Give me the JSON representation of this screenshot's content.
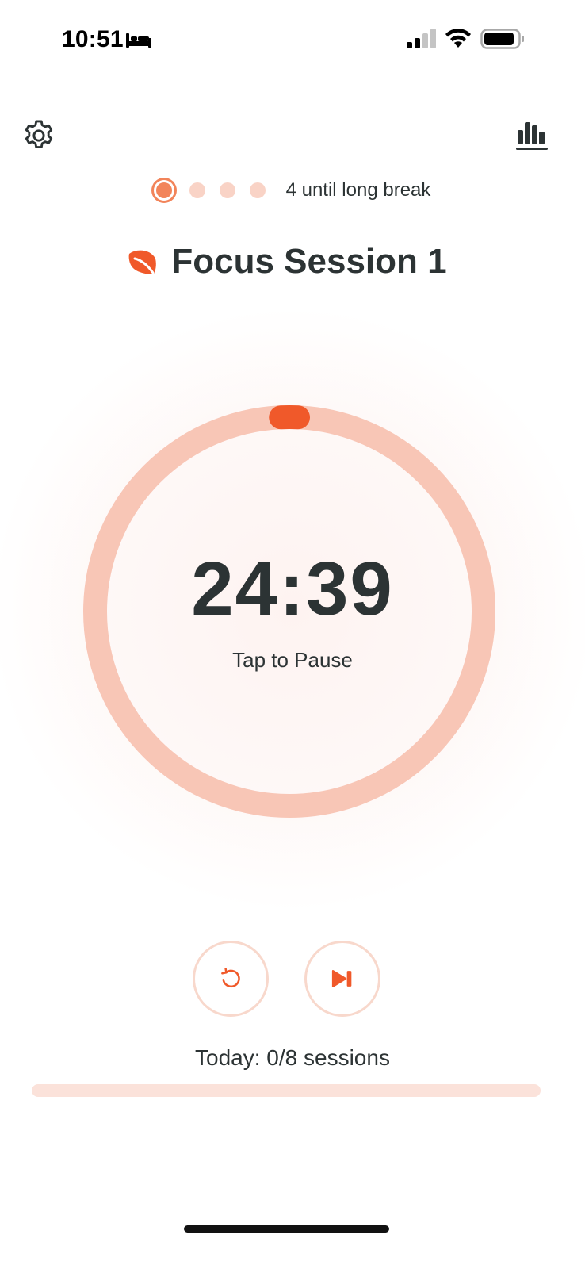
{
  "status_bar": {
    "time": "10:51",
    "icons": [
      "bed-icon",
      "cellular-signal-icon",
      "wifi-icon",
      "battery-icon"
    ]
  },
  "header": {
    "settings_icon": "gear-icon",
    "stats_icon": "bar-chart-icon"
  },
  "sessions": {
    "total_dots": 4,
    "current_index": 0,
    "label": "4 until long break"
  },
  "title": {
    "icon": "leaf-icon",
    "text": "Focus Session 1"
  },
  "timer": {
    "time": "24:39",
    "hint": "Tap to Pause",
    "progress_fraction": 0.014
  },
  "controls": {
    "restart_icon": "restart-icon",
    "skip_icon": "skip-forward-icon"
  },
  "today": {
    "label": "Today: 0/8 sessions",
    "completed": 0,
    "goal": 8
  },
  "colors": {
    "accent": "#F0592A",
    "ring_track": "#F8C6B6",
    "dot_inactive": "#F9D3C6",
    "dot_active": "#F2845A",
    "text": "#2C3334",
    "progress_track": "#FBE2DA"
  }
}
